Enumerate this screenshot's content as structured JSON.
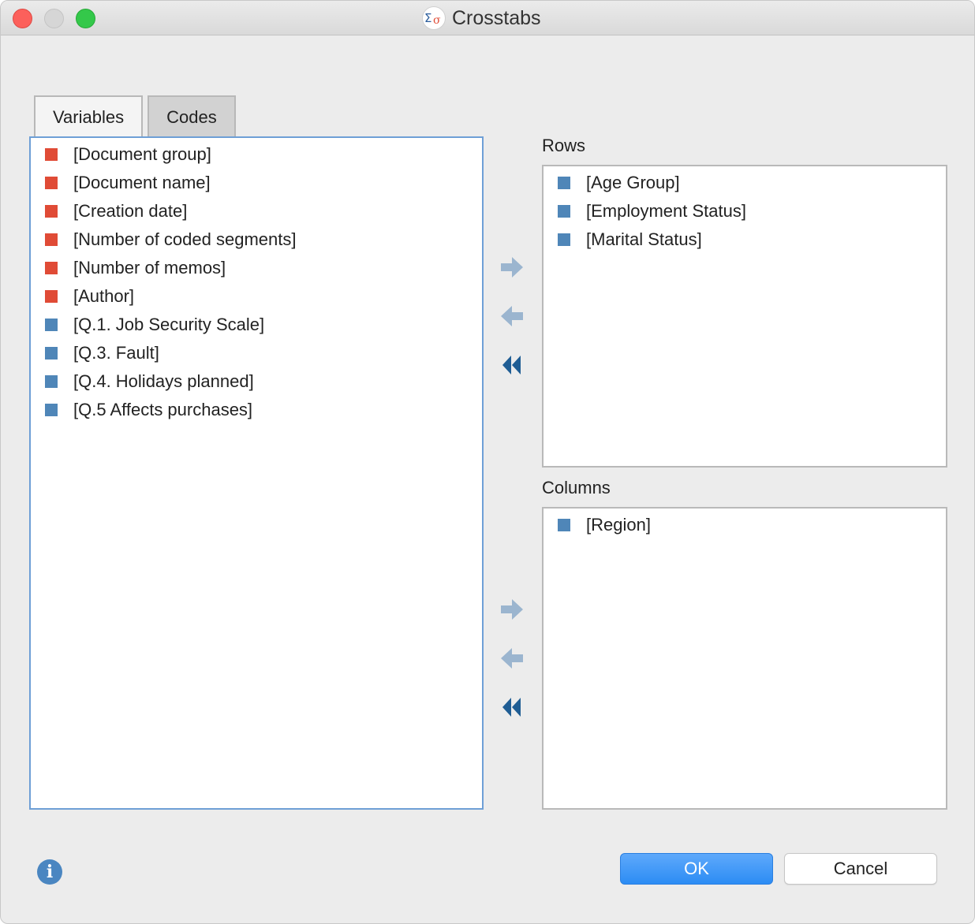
{
  "window": {
    "title": "Crosstabs"
  },
  "tabs": [
    {
      "label": "Variables",
      "active": false
    },
    {
      "label": "Codes",
      "active": true
    }
  ],
  "source_list": [
    {
      "label": "[Document group]",
      "color": "#e04b36"
    },
    {
      "label": "[Document name]",
      "color": "#e04b36"
    },
    {
      "label": "[Creation date]",
      "color": "#e04b36"
    },
    {
      "label": "[Number of coded segments]",
      "color": "#e04b36"
    },
    {
      "label": "[Number of memos]",
      "color": "#e04b36"
    },
    {
      "label": "[Author]",
      "color": "#e04b36"
    },
    {
      "label": "[Q.1. Job Security Scale]",
      "color": "#4f86b8"
    },
    {
      "label": "[Q.3. Fault]",
      "color": "#4f86b8"
    },
    {
      "label": "[Q.4. Holidays planned]",
      "color": "#4f86b8"
    },
    {
      "label": "[Q.5 Affects purchases]",
      "color": "#4f86b8"
    }
  ],
  "rows": {
    "label": "Rows",
    "items": [
      {
        "label": "[Age Group]",
        "color": "#4f86b8"
      },
      {
        "label": "[Employment Status]",
        "color": "#4f86b8"
      },
      {
        "label": "[Marital Status]",
        "color": "#4f86b8"
      }
    ]
  },
  "columns": {
    "label": "Columns",
    "items": [
      {
        "label": "[Region]",
        "color": "#4f86b8"
      }
    ]
  },
  "buttons": {
    "ok": "OK",
    "cancel": "Cancel"
  },
  "icons": {
    "add": "arrow-right-icon",
    "remove": "arrow-left-icon",
    "remove_all": "double-chevron-left-icon",
    "info": "info-icon"
  },
  "colors": {
    "arrow": "#9bb5cf",
    "double_arrow": "#1f5d94",
    "ok_button": "#2c8cf4",
    "focus_border": "#6e9fd6"
  }
}
